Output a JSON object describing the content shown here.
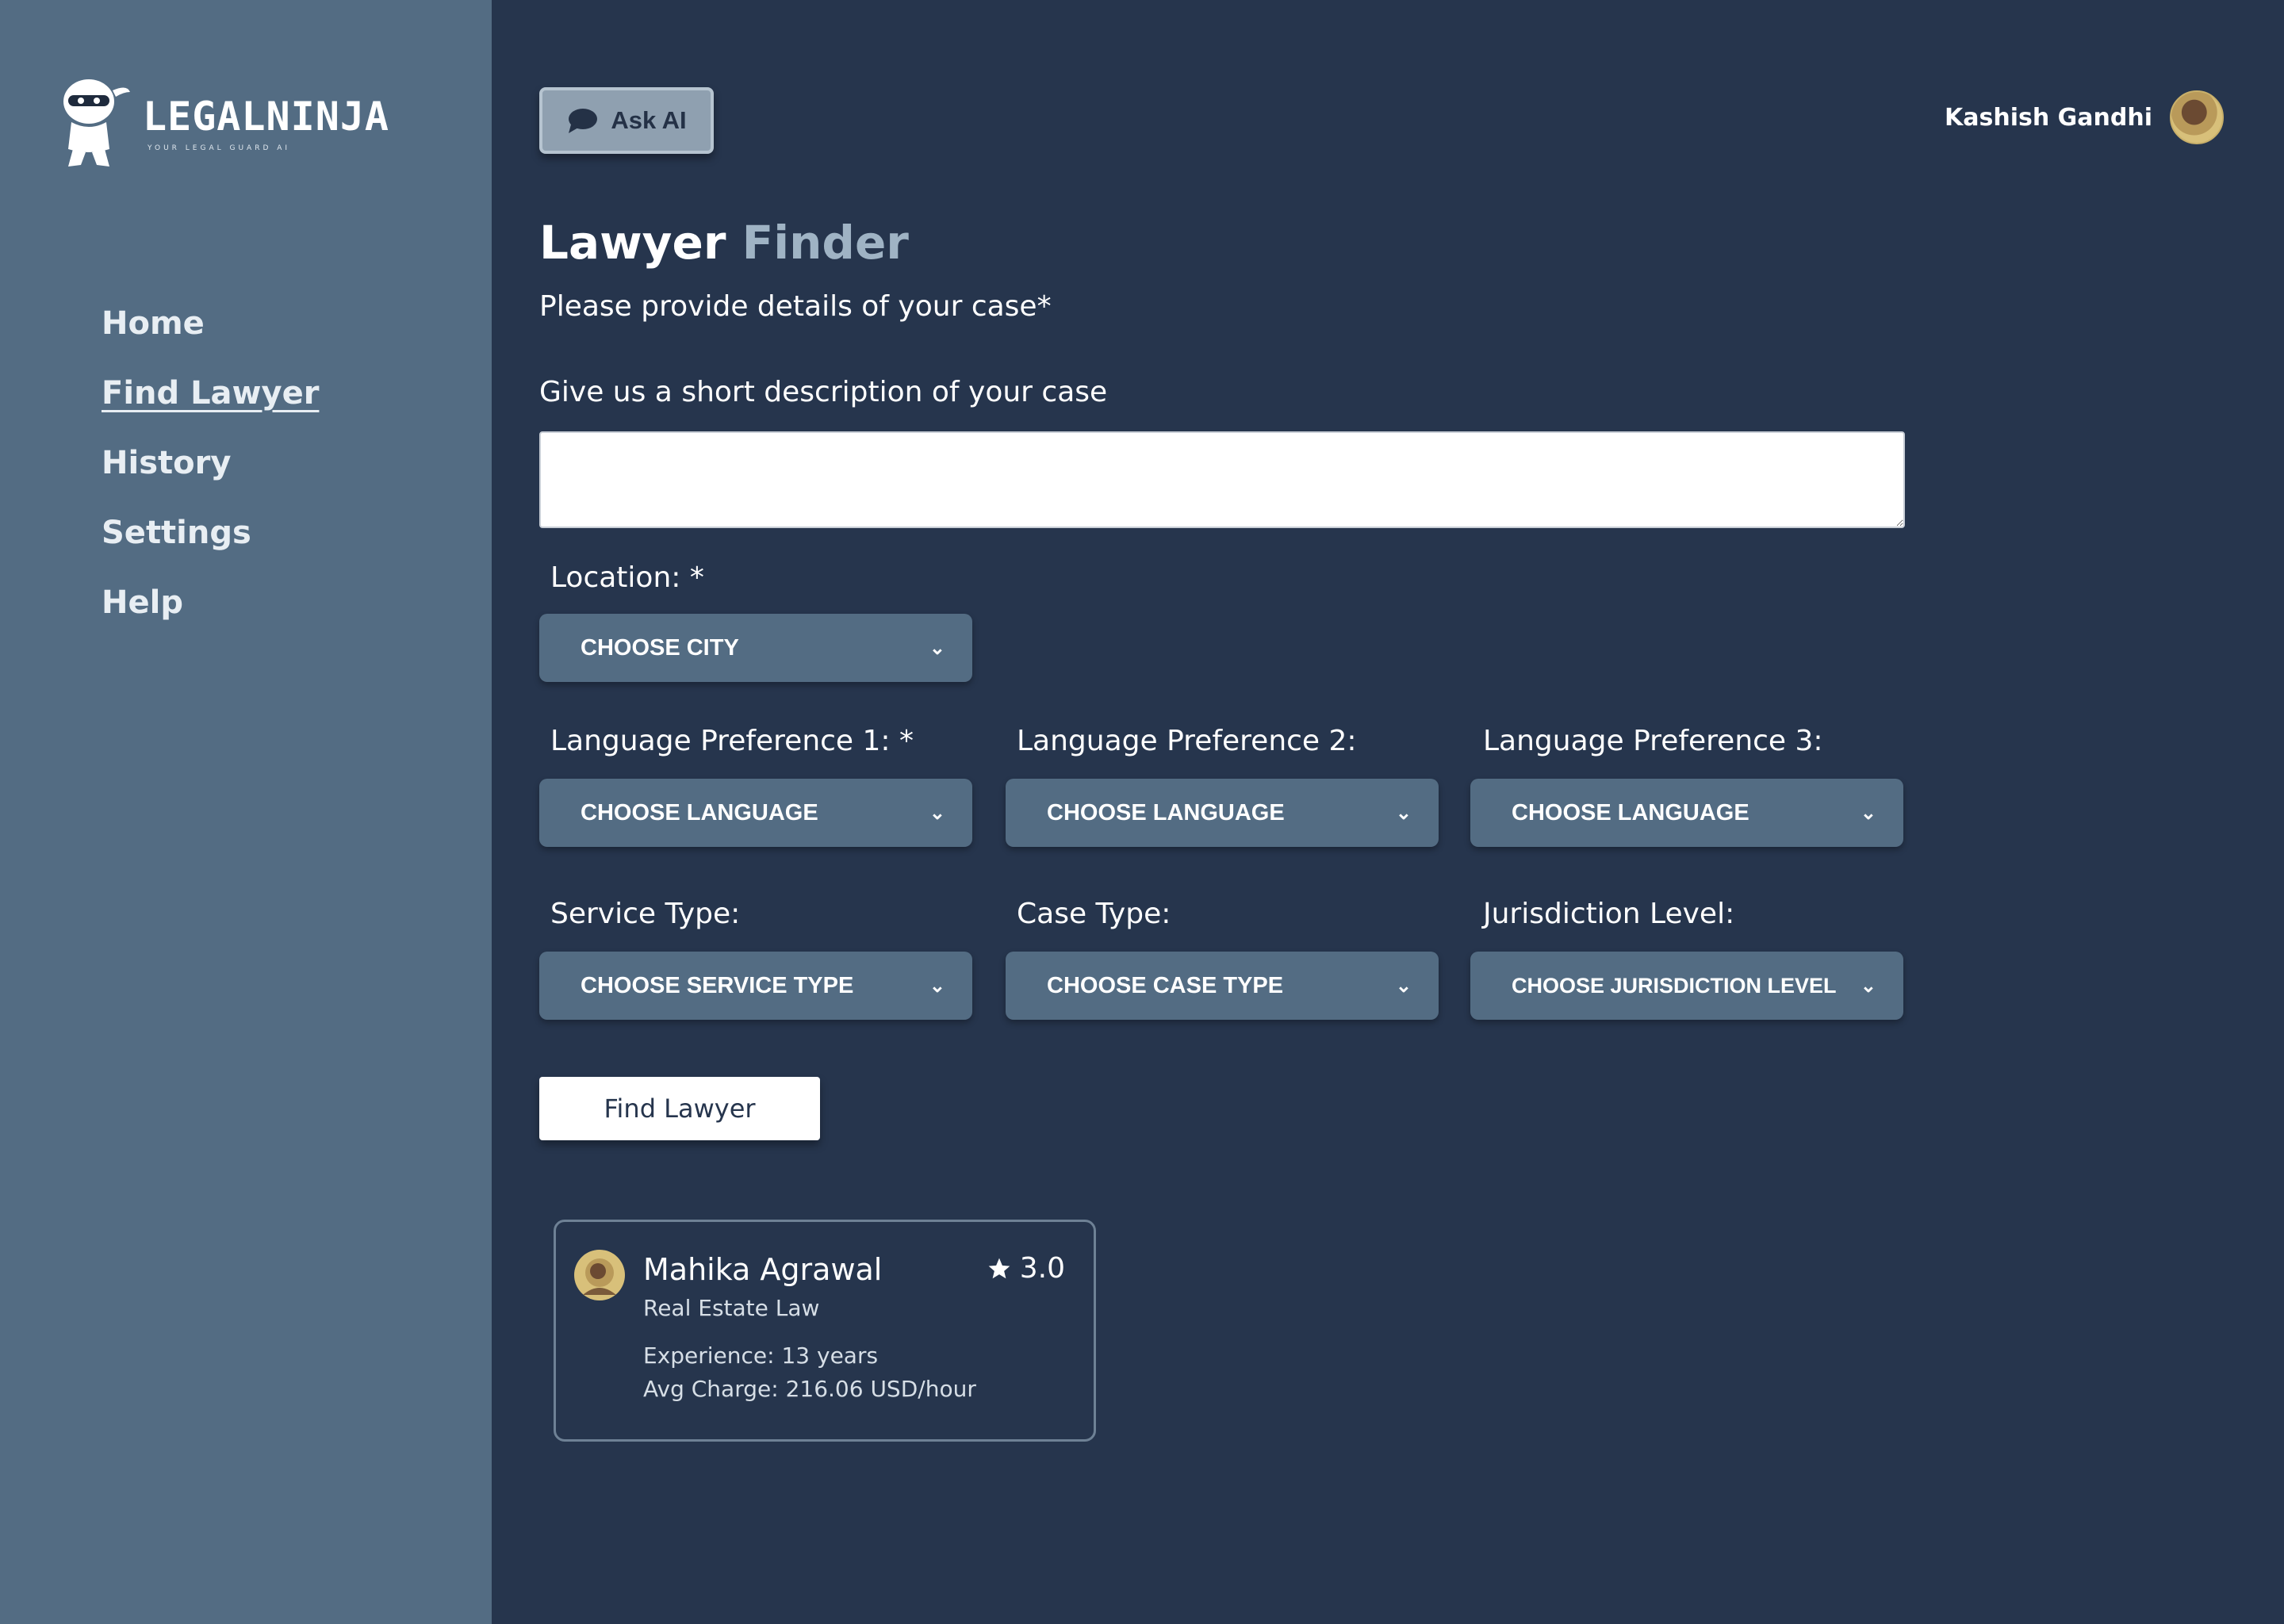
{
  "brand": {
    "name": "LEGALNINJA",
    "tagline": "YOUR LEGAL GUARD AI"
  },
  "sidebar": {
    "items": [
      {
        "label": "Home",
        "active": false
      },
      {
        "label": "Find Lawyer",
        "active": true
      },
      {
        "label": "History",
        "active": false
      },
      {
        "label": "Settings",
        "active": false
      },
      {
        "label": "Help",
        "active": false
      }
    ]
  },
  "header": {
    "ask_ai_label": "Ask AI",
    "user_name": "Kashish Gandhi",
    "chat_icon": "chat-bubble-icon"
  },
  "page": {
    "title_main": "Lawyer",
    "title_accent": "Finder",
    "subtitle": "Please provide details of your case*",
    "description_label": "Give us a short description of your case",
    "description_value": "",
    "description_placeholder": ""
  },
  "form": {
    "location": {
      "label": "Location: *",
      "value": "CHOOSE CITY"
    },
    "language1": {
      "label": "Language Preference 1: *",
      "value": "CHOOSE LANGUAGE"
    },
    "language2": {
      "label": "Language Preference 2:",
      "value": "CHOOSE LANGUAGE"
    },
    "language3": {
      "label": "Language Preference 3:",
      "value": "CHOOSE LANGUAGE"
    },
    "service_type": {
      "label": "Service Type:",
      "value": "CHOOSE SERVICE TYPE"
    },
    "case_type": {
      "label": "Case Type:",
      "value": "CHOOSE CASE TYPE"
    },
    "jurisdiction": {
      "label": "Jurisdiction Level:",
      "value": "CHOOSE JURISDICTION LEVEL"
    },
    "submit_label": "Find Lawyer"
  },
  "results": [
    {
      "name": "Mahika Agrawal",
      "rating": "3.0",
      "practice_area": "Real Estate Law",
      "experience": "Experience: 13 years",
      "charge": "Avg Charge: 216.06 USD/hour"
    }
  ],
  "colors": {
    "background": "#26354d",
    "sidebar": "#536c83",
    "accent_text": "#9fb3c4",
    "select_bg": "#536c83",
    "button_bg": "#ffffff"
  }
}
